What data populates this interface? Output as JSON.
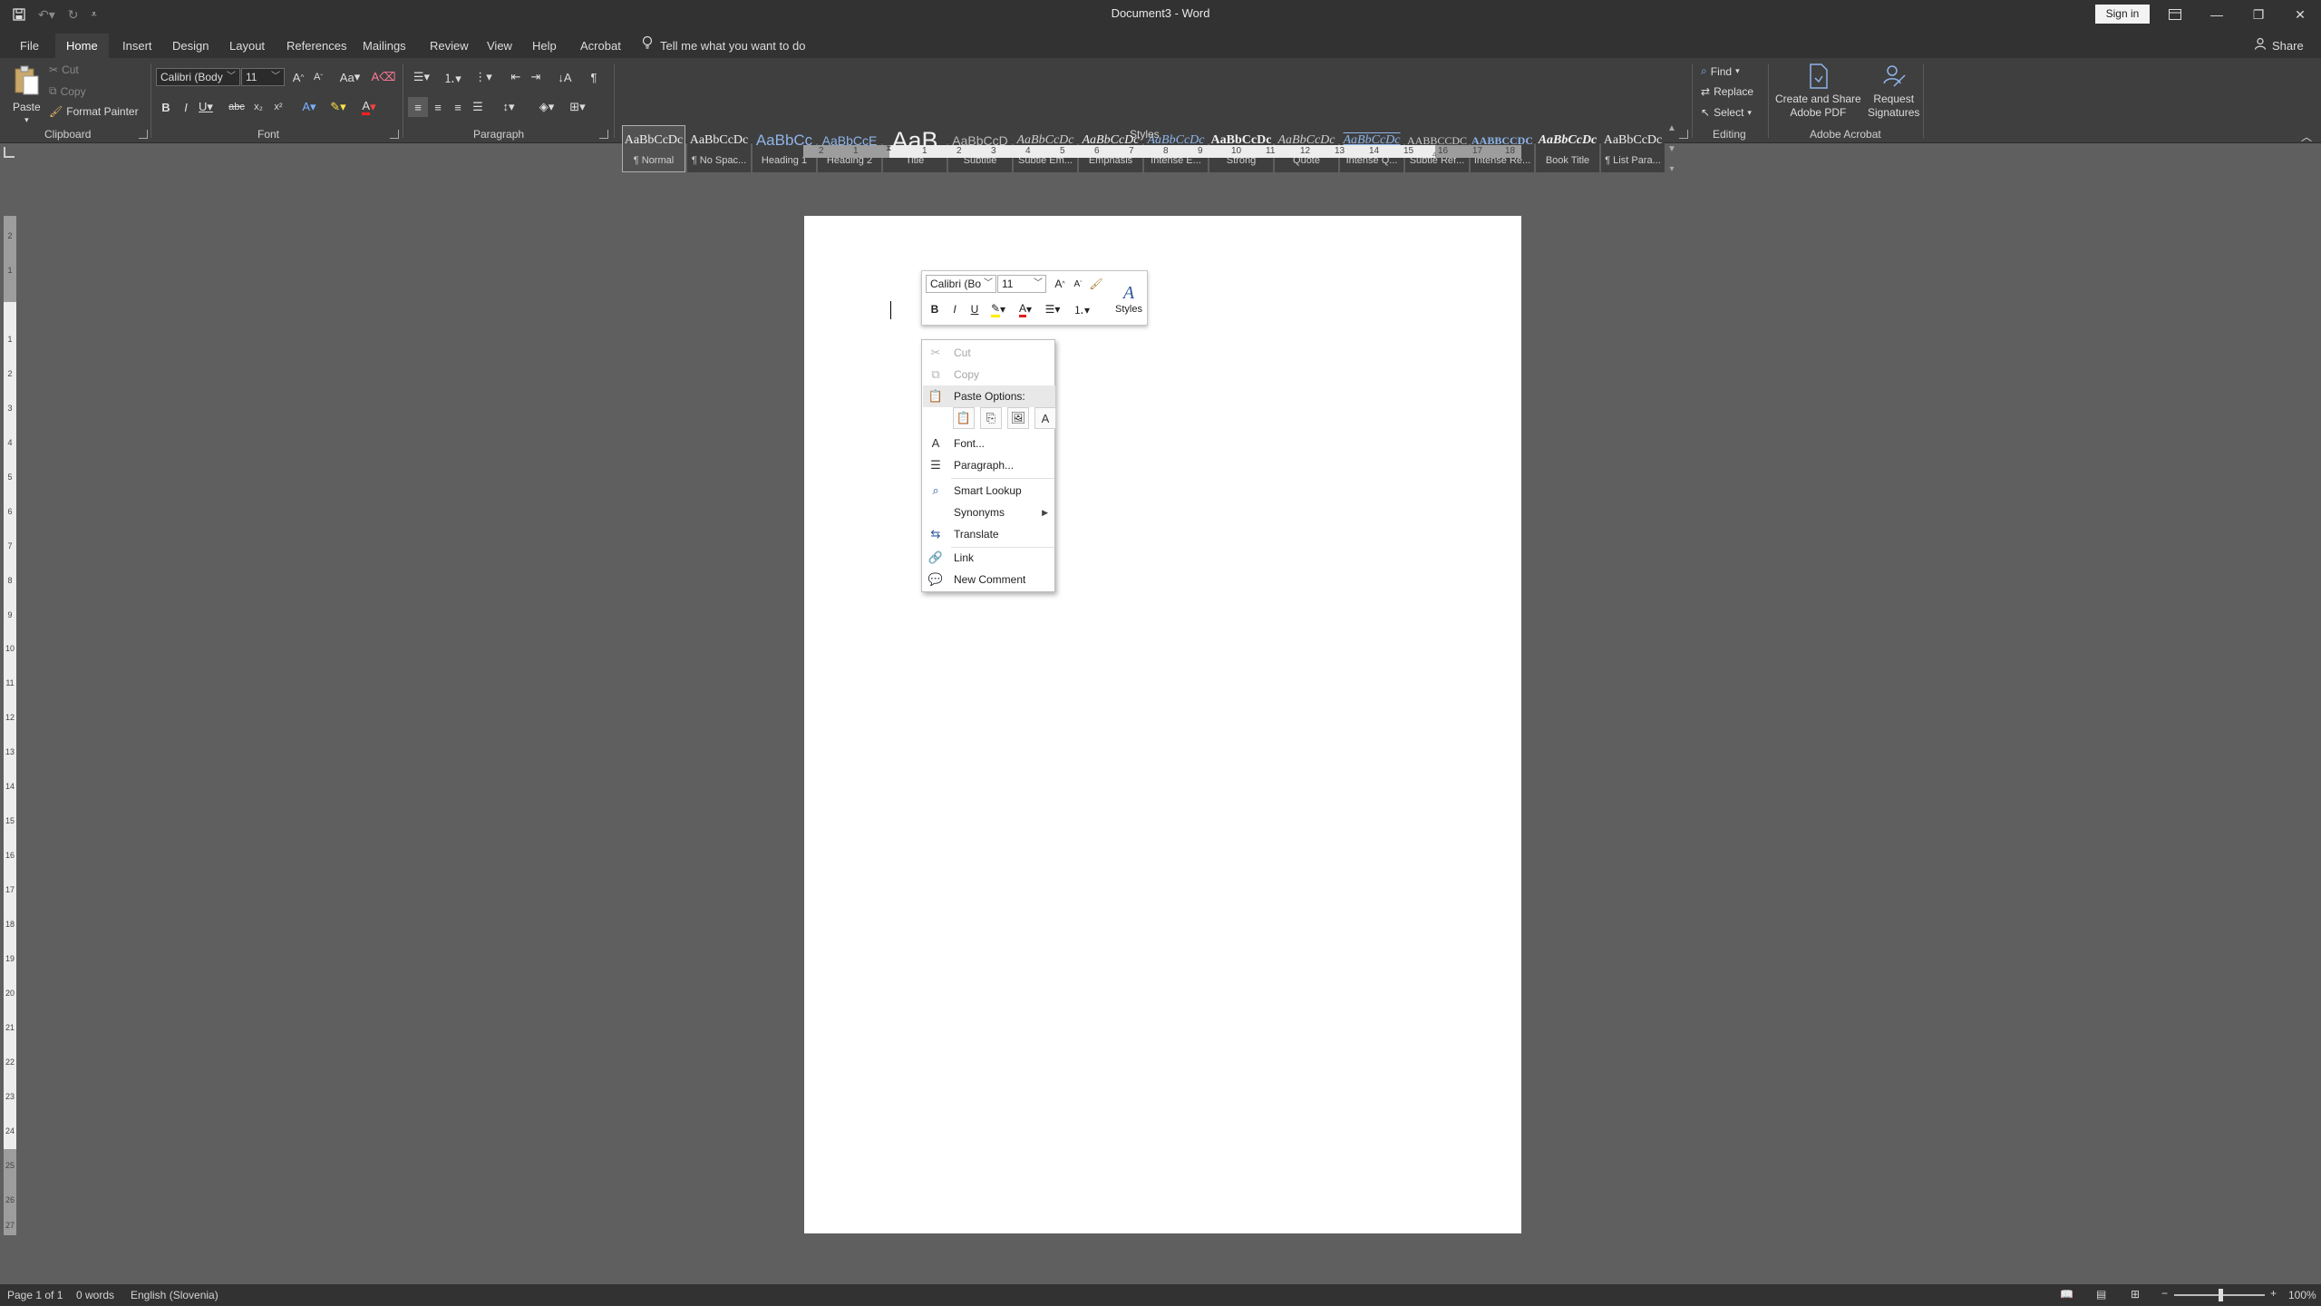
{
  "window": {
    "title": "Document3  -  Word",
    "sign_in": "Sign in"
  },
  "tabs": [
    "File",
    "Home",
    "Insert",
    "Design",
    "Layout",
    "References",
    "Mailings",
    "Review",
    "View",
    "Help",
    "Acrobat"
  ],
  "tell_me": "Tell me what you want to do",
  "share": "Share",
  "ribbon": {
    "clipboard": {
      "paste": "Paste",
      "cut": "Cut",
      "copy": "Copy",
      "format_painter": "Format Painter",
      "label": "Clipboard"
    },
    "font": {
      "name": "Calibri (Body",
      "size": "11",
      "label": "Font",
      "change_case": "Aa"
    },
    "paragraph": {
      "label": "Paragraph"
    },
    "styles": {
      "label": "Styles",
      "items": [
        {
          "preview": "AaBbCcDc",
          "name": "¶ Normal"
        },
        {
          "preview": "AaBbCcDc",
          "name": "¶ No Spac..."
        },
        {
          "preview": "AaBbCc",
          "name": "Heading 1"
        },
        {
          "preview": "AaBbCcE",
          "name": "Heading 2"
        },
        {
          "preview": "AaB",
          "name": "Title"
        },
        {
          "preview": "AaBbCcD",
          "name": "Subtitle"
        },
        {
          "preview": "AaBbCcDc",
          "name": "Subtle Em..."
        },
        {
          "preview": "AaBbCcDc",
          "name": "Emphasis"
        },
        {
          "preview": "AaBbCcDc",
          "name": "Intense E..."
        },
        {
          "preview": "AaBbCcDc",
          "name": "Strong"
        },
        {
          "preview": "AaBbCcDc",
          "name": "Quote"
        },
        {
          "preview": "AaBbCcDc",
          "name": "Intense Q..."
        },
        {
          "preview": "AABBCCDC",
          "name": "Subtle Ref..."
        },
        {
          "preview": "AABBCCDC",
          "name": "Intense Re..."
        },
        {
          "preview": "AaBbCcDc",
          "name": "Book Title"
        },
        {
          "preview": "AaBbCcDc",
          "name": "¶ List Para..."
        }
      ]
    },
    "editing": {
      "find": "Find",
      "replace": "Replace",
      "select": "Select",
      "label": "Editing"
    },
    "acrobat": {
      "create_share": "Create and Share",
      "create_share_2": "Adobe PDF",
      "request": "Request",
      "request_2": "Signatures",
      "label": "Adobe Acrobat"
    }
  },
  "ruler": {
    "h_numbers": [
      "2",
      "1",
      "1",
      "2",
      "3",
      "4",
      "5",
      "6",
      "7",
      "8",
      "9",
      "10",
      "11",
      "12",
      "13",
      "14",
      "15",
      "16",
      "17",
      "18"
    ],
    "v_numbers": [
      "2",
      "1",
      "1",
      "2",
      "3",
      "4",
      "5",
      "6",
      "7",
      "8",
      "9",
      "10",
      "11",
      "12",
      "13",
      "14",
      "15",
      "16",
      "17",
      "18",
      "19",
      "20",
      "21",
      "22",
      "23",
      "24",
      "25",
      "26",
      "27"
    ]
  },
  "mini_toolbar": {
    "font": "Calibri (Bo",
    "size": "11",
    "styles": "Styles"
  },
  "context_menu": {
    "cut": "Cut",
    "copy": "Copy",
    "paste_options": "Paste Options:",
    "font": "Font...",
    "paragraph": "Paragraph...",
    "smart_lookup": "Smart Lookup",
    "synonyms": "Synonyms",
    "translate": "Translate",
    "link": "Link",
    "new_comment": "New Comment"
  },
  "status": {
    "page": "Page 1 of 1",
    "words": "0 words",
    "language": "English (Slovenia)",
    "zoom": "100%"
  }
}
